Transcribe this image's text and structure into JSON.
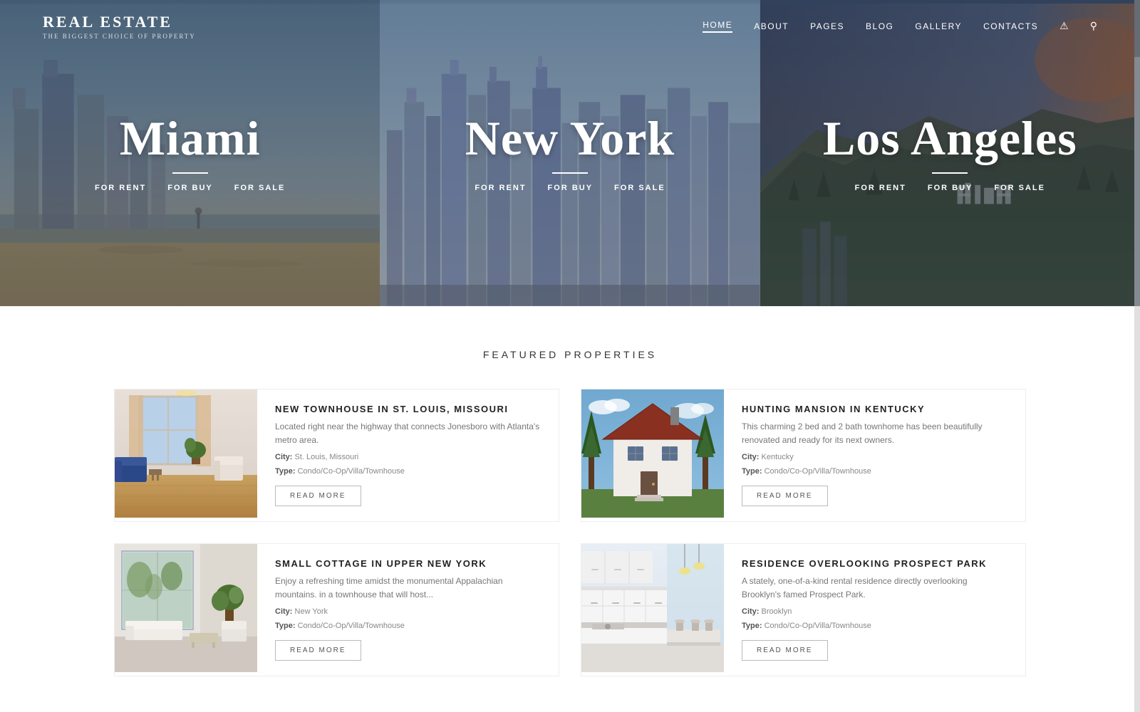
{
  "site": {
    "logo": "REAL ESTATE",
    "tagline": "THE BIGGEST CHOICE OF PROPERTY"
  },
  "nav": {
    "items": [
      {
        "label": "HOME",
        "active": true
      },
      {
        "label": "ABOUT",
        "active": false
      },
      {
        "label": "PAGES",
        "active": false
      },
      {
        "label": "BLOG",
        "active": false
      },
      {
        "label": "GALLERY",
        "active": false
      },
      {
        "label": "CONTACTS",
        "active": false
      }
    ]
  },
  "hero": {
    "panels": [
      {
        "city": "Miami",
        "links": [
          "FOR RENT",
          "FOR BUY",
          "FOR SALE"
        ],
        "type": "left"
      },
      {
        "city": "New York",
        "links": [
          "FOR RENT",
          "FOR BUY",
          "FOR SALE"
        ],
        "type": "center"
      },
      {
        "city": "Los Angeles",
        "links": [
          "FOR RENT",
          "FOR BUY",
          "FOR SALE"
        ],
        "type": "right"
      }
    ]
  },
  "featured": {
    "title": "FEATURED PROPERTIES",
    "properties": [
      {
        "id": 1,
        "title": "NEW TOWNHOUSE IN ST. LOUIS, MISSOURI",
        "description": "Located right near the highway that connects Jonesboro with Atlanta's metro area.",
        "city": "St. Louis, Missouri",
        "type": "Condo/Co-Op/Villa/Townhouse",
        "read_more": "READ MORE",
        "image_type": "interior"
      },
      {
        "id": 2,
        "title": "HUNTING MANSION IN KENTUCKY",
        "description": "This charming 2 bed and 2 bath townhome has been beautifully renovated and ready for its next owners.",
        "city": "Kentucky",
        "type": "Condo/Co-Op/Villa/Townhouse",
        "read_more": "READ MORE",
        "image_type": "mansion"
      },
      {
        "id": 3,
        "title": "SMALL COTTAGE IN UPPER NEW YORK",
        "description": "Enjoy a refreshing time amidst the monumental Appalachian mountains. in a townhouse that will host...",
        "city": "New York",
        "type": "Condo/Co-Op/Villa/Townhouse",
        "read_more": "READ MORE",
        "image_type": "cottage"
      },
      {
        "id": 4,
        "title": "RESIDENCE OVERLOOKING PROSPECT PARK",
        "description": "A stately, one-of-a-kind rental residence directly overlooking Brooklyn's famed Prospect Park.",
        "city": "Brooklyn",
        "type": "Condo/Co-Op/Villa/Townhouse",
        "read_more": "READ MORE",
        "image_type": "modern"
      }
    ]
  },
  "labels": {
    "city_prefix": "City:",
    "type_prefix": "Type:"
  }
}
